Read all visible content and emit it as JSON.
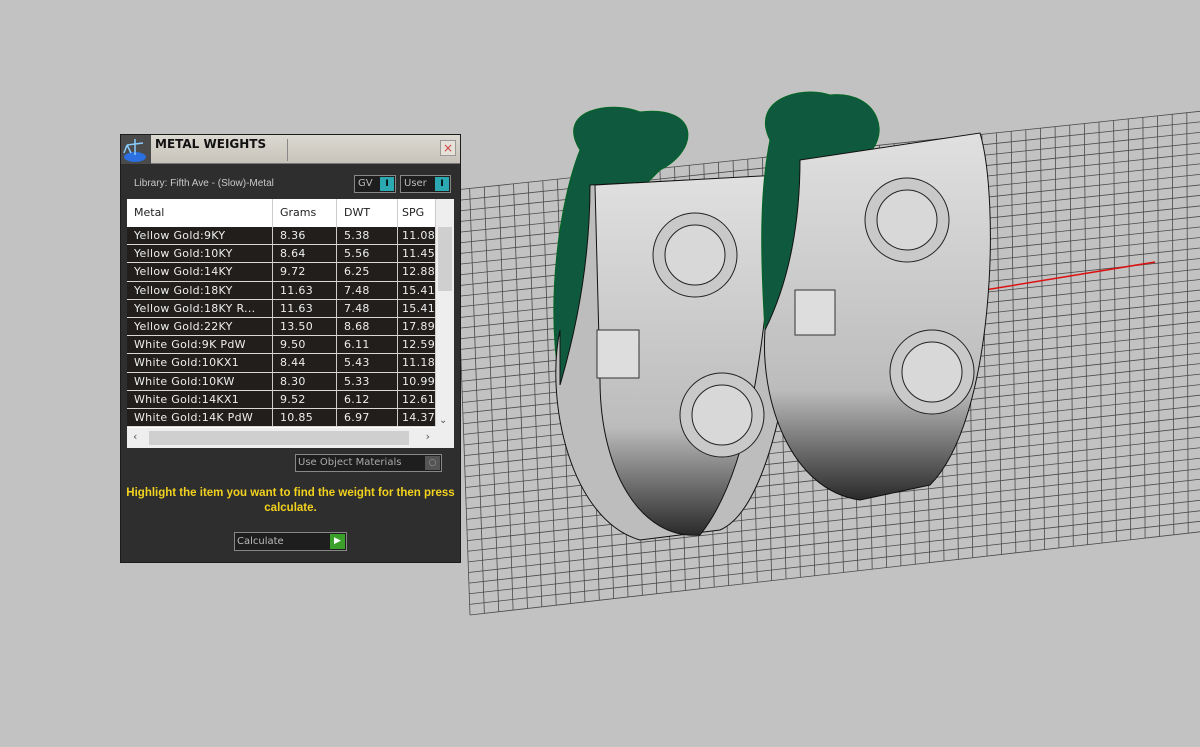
{
  "panel": {
    "title": "METAL WEIGHTS",
    "close_icon": "×",
    "library_label": "Library: Fifth Ave - (Slow)-Metal",
    "toggle_gv": "GV",
    "toggle_user": "User",
    "columns": [
      "Metal",
      "Grams",
      "DWT",
      "SPG"
    ],
    "rows": [
      [
        "Yellow Gold:9KY",
        "8.36",
        "5.38",
        "11.08"
      ],
      [
        "Yellow Gold:10KY",
        "8.64",
        "5.56",
        "11.45"
      ],
      [
        "Yellow Gold:14KY",
        "9.72",
        "6.25",
        "12.88"
      ],
      [
        "Yellow Gold:18KY",
        "11.63",
        "7.48",
        "15.41"
      ],
      [
        "Yellow Gold:18KY R...",
        "11.63",
        "7.48",
        "15.41"
      ],
      [
        "Yellow Gold:22KY",
        "13.50",
        "8.68",
        "17.89"
      ],
      [
        "White Gold:9K PdW",
        "9.50",
        "6.11",
        "12.59"
      ],
      [
        "White Gold:10KX1",
        "8.44",
        "5.43",
        "11.18"
      ],
      [
        "White Gold:10KW",
        "8.30",
        "5.33",
        "10.99"
      ],
      [
        "White Gold:14KX1",
        "9.52",
        "6.12",
        "12.61"
      ],
      [
        "White Gold:14K PdW",
        "10.85",
        "6.97",
        "14.37"
      ]
    ],
    "use_object_materials": "Use Object Materials",
    "instruction": "Highlight the item you want to find the weight for then press calculate.",
    "calculate_label": "Calculate"
  },
  "colors": {
    "accent": "#2aa9b0",
    "message": "#f2d21e",
    "go": "#3aa02a",
    "clasp": "#0f5a3e"
  }
}
